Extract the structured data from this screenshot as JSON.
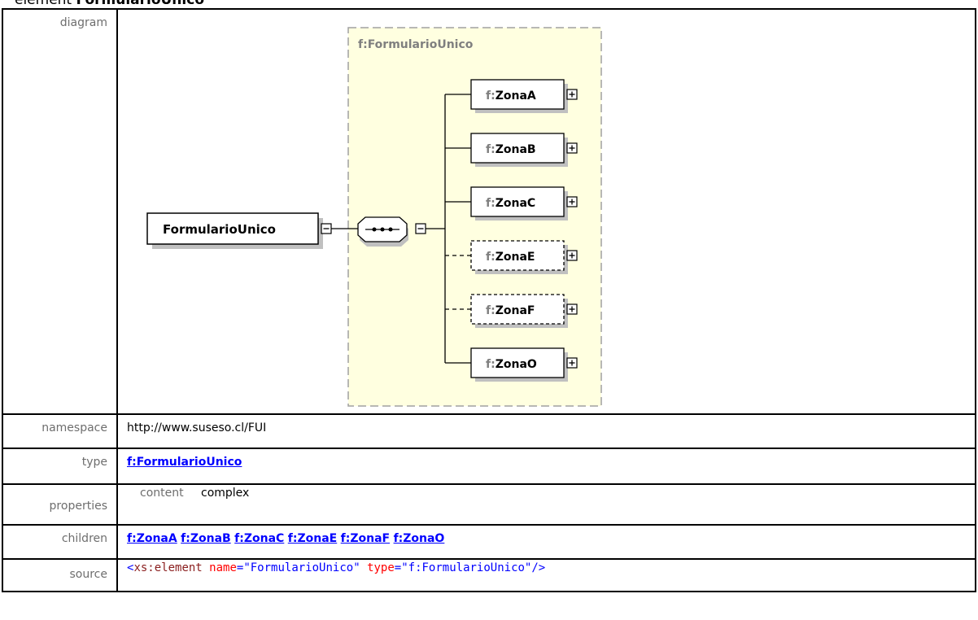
{
  "heading": {
    "prefix": "element",
    "name": "FormularioUnico"
  },
  "rows": {
    "diagram": {
      "label": "diagram"
    },
    "namespace": {
      "label": "namespace",
      "value": "http://www.suseso.cl/FUI"
    },
    "type": {
      "label": "type",
      "value": "f:FormularioUnico"
    },
    "properties": {
      "label": "properties",
      "key": "content",
      "value": "complex"
    },
    "children": {
      "label": "children",
      "items": [
        "f:ZonaA",
        "f:ZonaB",
        "f:ZonaC",
        "f:ZonaE",
        "f:ZonaF",
        "f:ZonaO"
      ]
    },
    "source": {
      "label": "source",
      "open": "<",
      "tag": "xs:element",
      "attr1": "name",
      "eq1": "=",
      "val1": "\"FormularioUnico\"",
      "attr2": "type",
      "eq2": "=",
      "val2": "\"f:FormularioUnico\"",
      "close": "/>"
    }
  },
  "diagram": {
    "group_title": "f:FormularioUnico",
    "root": "FormularioUnico",
    "children": [
      {
        "prefix": "f:",
        "name": "ZonaA",
        "optional": false
      },
      {
        "prefix": "f:",
        "name": "ZonaB",
        "optional": false
      },
      {
        "prefix": "f:",
        "name": "ZonaC",
        "optional": false
      },
      {
        "prefix": "f:",
        "name": "ZonaE",
        "optional": true
      },
      {
        "prefix": "f:",
        "name": "ZonaF",
        "optional": true
      },
      {
        "prefix": "f:",
        "name": "ZonaO",
        "optional": false
      }
    ],
    "colors": {
      "group_fill": "#ffffe0",
      "group_border": "#a0a0a0",
      "box_shadow": "#c0c0c0",
      "prefix_color": "#7f7f7f"
    }
  }
}
